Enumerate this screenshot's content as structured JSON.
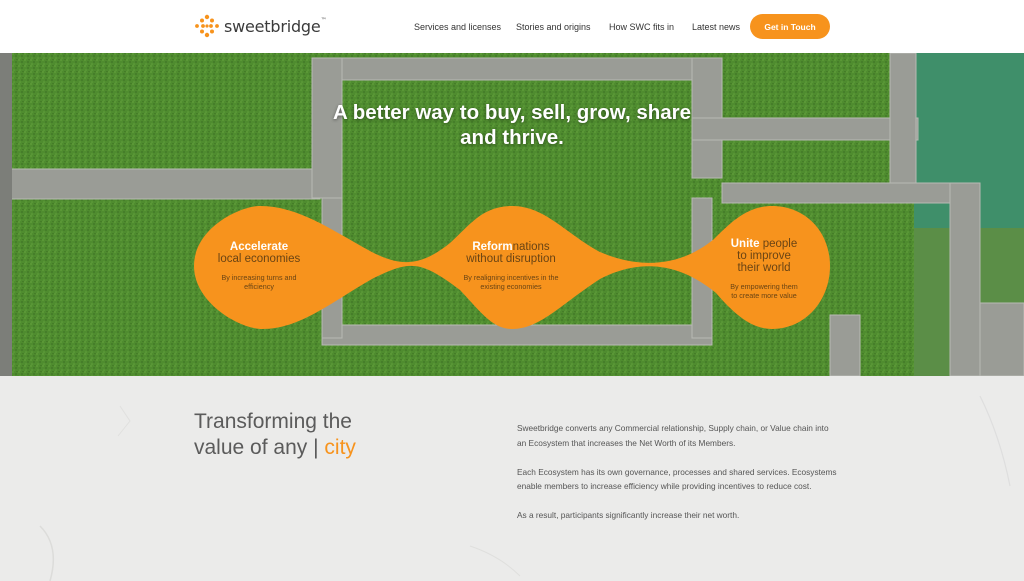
{
  "brand": {
    "name": "sweetbridge",
    "tm": "™",
    "accent": "#f7931d"
  },
  "nav": {
    "items": [
      {
        "label": "Services and licenses"
      },
      {
        "label": "Stories and origins"
      },
      {
        "label": "How SWC fits in"
      },
      {
        "label": "Latest news"
      }
    ],
    "cta": "Get in Touch"
  },
  "hero": {
    "headline_line1": "A better way to buy, sell, grow, share",
    "headline_line2": "and thrive.",
    "cards": [
      {
        "lead_white": "Accelerate",
        "lead_dark": "local economies",
        "sub_line1": "By increasing turns and",
        "sub_line2": "efficiency"
      },
      {
        "lead_white": "Reform",
        "lead_dark_a": "nations",
        "lead_dark_b": "without disruption",
        "sub_line1": "By realigning incentives in the",
        "sub_line2": "existing economies"
      },
      {
        "lead_white": "Unite",
        "lead_dark_a": "people",
        "lead_dark_b": "to improve",
        "lead_dark_c": "their world",
        "sub_line1": "By empowering them",
        "sub_line2": "to create more value"
      }
    ]
  },
  "section": {
    "title_line1": "Transforming the",
    "title_line2": "value of any",
    "title_bar": "|",
    "title_accent": "city",
    "paragraphs": [
      "Sweetbridge converts any Commercial relationship, Supply chain, or Value chain into an Ecosystem that increases the Net Worth of its Members.",
      "Each Ecosystem has its own governance, processes and shared services. Ecosystems enable members to increase efficiency while providing incentives to reduce cost.",
      "As a result, participants significantly increase their net worth."
    ]
  }
}
